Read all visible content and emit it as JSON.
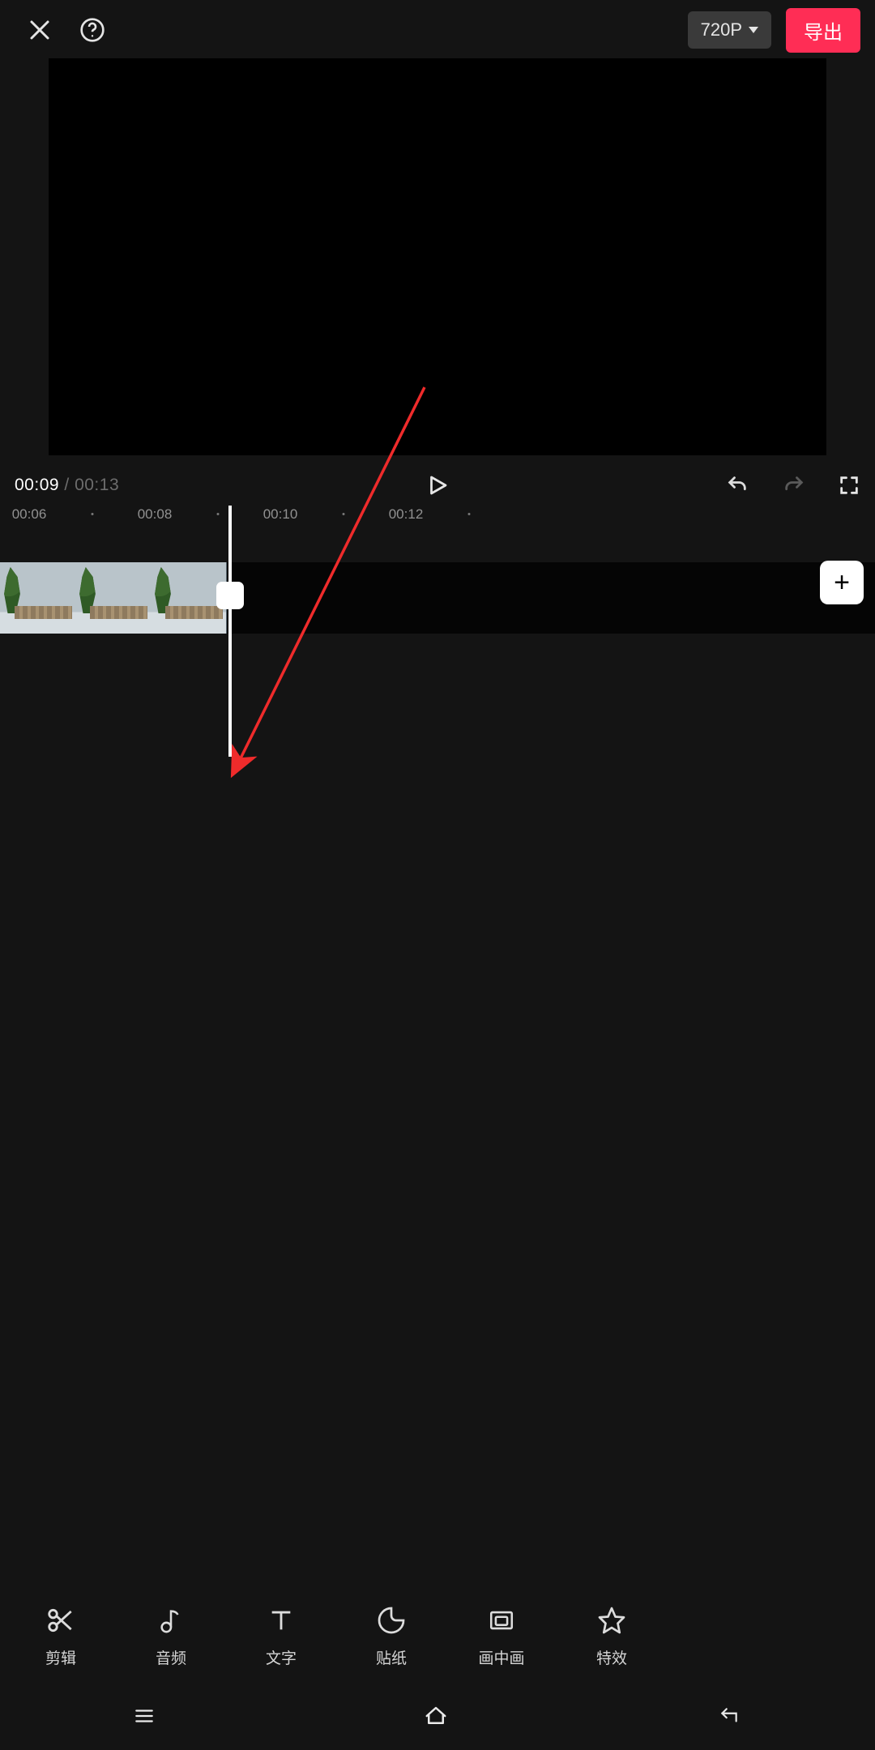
{
  "header": {
    "resolution_label": "720P",
    "export_label": "导出"
  },
  "playback": {
    "current_time": "00:09",
    "separator": " / ",
    "duration": "00:13"
  },
  "ruler": {
    "ticks": [
      "00:06",
      "00:08",
      "00:10",
      "00:12"
    ]
  },
  "add_clip_label": "+",
  "tools": [
    {
      "id": "cut",
      "label": "剪辑"
    },
    {
      "id": "audio",
      "label": "音频"
    },
    {
      "id": "text",
      "label": "文字"
    },
    {
      "id": "sticker",
      "label": "贴纸"
    },
    {
      "id": "pip",
      "label": "画中画"
    },
    {
      "id": "fx",
      "label": "特效"
    }
  ]
}
